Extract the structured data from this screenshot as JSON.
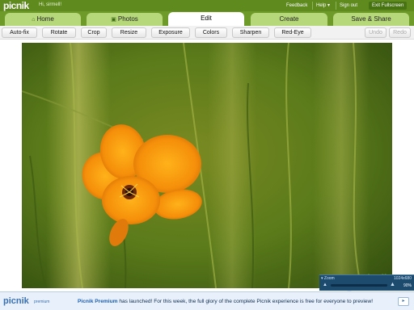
{
  "app": {
    "logo": "picnik",
    "greeting": "Hi, sirmell!"
  },
  "top_links": {
    "feedback": "Feedback",
    "help": "Help ▾",
    "sign_out": "Sign out",
    "exit_fullscreen": "Exit Fullscreen"
  },
  "tabs": [
    {
      "label": "Home",
      "icon": "home-icon",
      "active": false
    },
    {
      "label": "Photos",
      "icon": "photos-icon",
      "active": false
    },
    {
      "label": "Edit",
      "icon": "",
      "active": true
    },
    {
      "label": "Create",
      "icon": "",
      "active": false
    },
    {
      "label": "Save & Share",
      "icon": "",
      "active": false
    }
  ],
  "toolbar": {
    "tools": [
      "Auto-fix",
      "Rotate",
      "Crop",
      "Resize",
      "Exposure",
      "Colors",
      "Sharpen",
      "Red-Eye"
    ],
    "undo": "Undo",
    "redo": "Redo"
  },
  "zoom": {
    "label": "▾ Zoom",
    "dimensions": "1024x680",
    "percent": "90%",
    "level": 0.1
  },
  "bottom": {
    "logo": "picnik",
    "logo_sub": "premium",
    "msg_strong": "Picnik Premium",
    "msg_rest": " has launched! For this week, the full glory of the complete Picnik experience is free for everyone to preview!",
    "arrow": "▸"
  },
  "colors": {
    "top_bar": "#5e8a1e",
    "tab_inactive": "#b6d87a",
    "zoom_bg": "#1d4b6e",
    "banner_bg": "#e8f1fb"
  }
}
